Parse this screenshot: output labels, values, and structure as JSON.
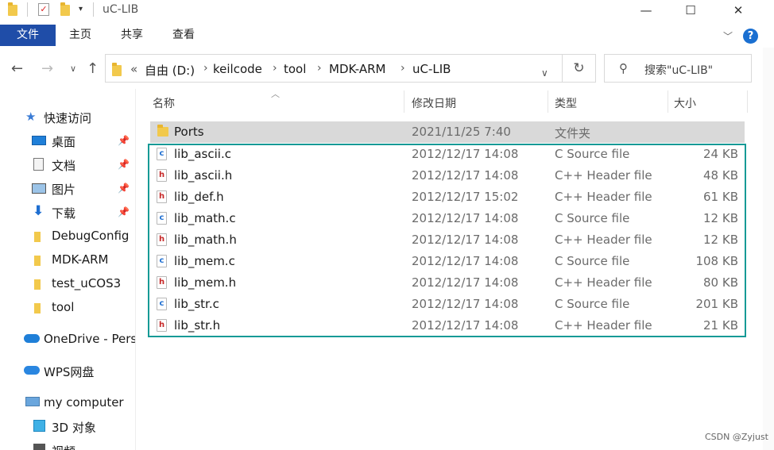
{
  "window": {
    "title": "uC-LIB",
    "minimize": "—",
    "maximize": "☐",
    "close": "✕"
  },
  "ribbon": {
    "file_tab": "文件",
    "tabs": [
      "主页",
      "共享",
      "查看"
    ],
    "help": "?"
  },
  "address": {
    "prefix": "«",
    "crumbs": [
      "自由 (D:)",
      "keilcode",
      "tool",
      "MDK-ARM",
      "uC-LIB"
    ],
    "search_placeholder": "搜索\"uC-LIB\""
  },
  "sidebar": {
    "items": [
      {
        "label": "快速访问",
        "icon": "star-icon"
      },
      {
        "label": "桌面",
        "icon": "desktop-icon",
        "pinned": true
      },
      {
        "label": "文档",
        "icon": "document-icon",
        "pinned": true
      },
      {
        "label": "图片",
        "icon": "picture-icon",
        "pinned": true
      },
      {
        "label": "下载",
        "icon": "download-icon",
        "pinned": true
      },
      {
        "label": "DebugConfig",
        "icon": "folder-icon"
      },
      {
        "label": "MDK-ARM",
        "icon": "folder-icon"
      },
      {
        "label": "test_uCOS3",
        "icon": "folder-icon"
      },
      {
        "label": "tool",
        "icon": "folder-icon"
      },
      {
        "label": "OneDrive - Pers",
        "icon": "cloud-icon"
      },
      {
        "label": "WPS网盘",
        "icon": "wps-cloud-icon"
      },
      {
        "label": "my computer",
        "icon": "computer-icon"
      },
      {
        "label": "3D 对象",
        "icon": "3d-object-icon"
      },
      {
        "label": "视频",
        "icon": "video-icon"
      }
    ]
  },
  "columns": {
    "name": "名称",
    "date": "修改日期",
    "type": "类型",
    "size": "大小"
  },
  "files": [
    {
      "name": "Ports",
      "date": "2021/11/25 7:40",
      "type": "文件夹",
      "size": "",
      "kind": "folder"
    },
    {
      "name": "lib_ascii.c",
      "date": "2012/12/17 14:08",
      "type": "C Source file",
      "size": "24 KB",
      "kind": "c"
    },
    {
      "name": "lib_ascii.h",
      "date": "2012/12/17 14:08",
      "type": "C++ Header file",
      "size": "48 KB",
      "kind": "h"
    },
    {
      "name": "lib_def.h",
      "date": "2012/12/17 15:02",
      "type": "C++ Header file",
      "size": "61 KB",
      "kind": "h"
    },
    {
      "name": "lib_math.c",
      "date": "2012/12/17 14:08",
      "type": "C Source file",
      "size": "12 KB",
      "kind": "c"
    },
    {
      "name": "lib_math.h",
      "date": "2012/12/17 14:08",
      "type": "C++ Header file",
      "size": "12 KB",
      "kind": "h"
    },
    {
      "name": "lib_mem.c",
      "date": "2012/12/17 14:08",
      "type": "C Source file",
      "size": "108 KB",
      "kind": "c"
    },
    {
      "name": "lib_mem.h",
      "date": "2012/12/17 14:08",
      "type": "C++ Header file",
      "size": "80 KB",
      "kind": "h"
    },
    {
      "name": "lib_str.c",
      "date": "2012/12/17 14:08",
      "type": "C Source file",
      "size": "201 KB",
      "kind": "c"
    },
    {
      "name": "lib_str.h",
      "date": "2012/12/17 14:08",
      "type": "C++ Header file",
      "size": "21 KB",
      "kind": "h"
    }
  ],
  "watermark": "CSDN @Zyjust",
  "colors": {
    "accent": "#1f4da8",
    "highlight": "#169a96",
    "selected_row": "#d9d9d9"
  }
}
